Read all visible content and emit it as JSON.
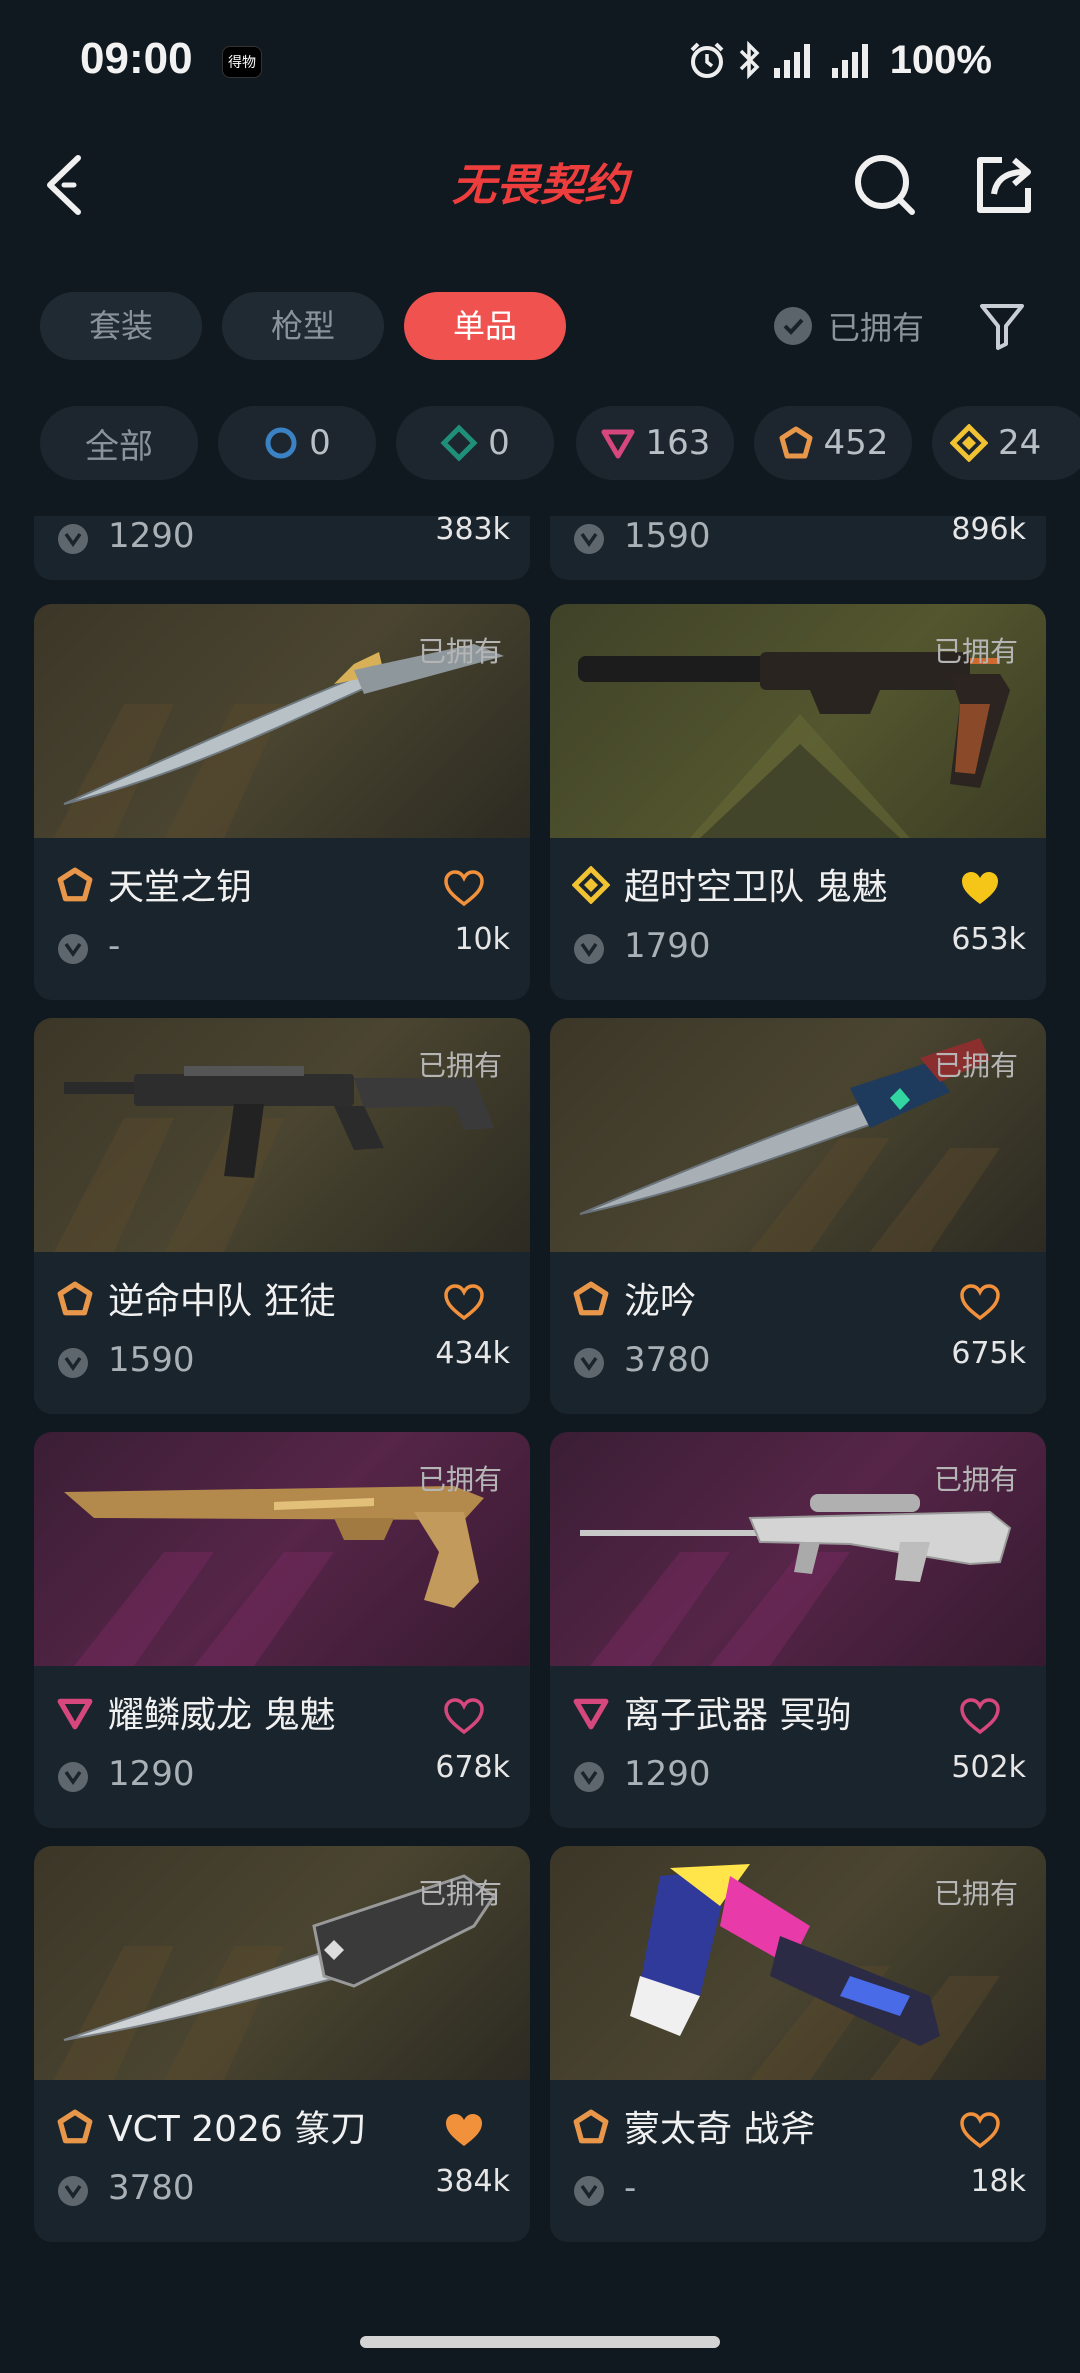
{
  "status_bar": {
    "time": "09:00",
    "app_badge": "得物",
    "battery": "100%"
  },
  "header": {
    "logo_text": "无畏契约"
  },
  "tabs": [
    {
      "label": "套装",
      "active": false
    },
    {
      "label": "枪型",
      "active": false
    },
    {
      "label": "单品",
      "active": true
    }
  ],
  "owned_filter": {
    "label": "已拥有"
  },
  "chips": [
    {
      "label": "全部"
    },
    {
      "tier": "select",
      "color": "#3b82c4",
      "count": "0"
    },
    {
      "tier": "deluxe",
      "color": "#1f8f7a",
      "count": "0"
    },
    {
      "tier": "premium",
      "color": "#d6477d",
      "count": "163"
    },
    {
      "tier": "exclusive",
      "color": "#e8964a",
      "count": "452"
    },
    {
      "tier": "ultra",
      "color": "#f1c232",
      "count": "24"
    }
  ],
  "items": [
    {
      "name": "",
      "price": "1290",
      "likes": "383k",
      "partial": "top"
    },
    {
      "name": "",
      "price": "1590",
      "likes": "896k",
      "partial": "top"
    },
    {
      "name": "天堂之钥",
      "tier": "exclusive",
      "price": "-",
      "likes": "10k",
      "owned": "已拥有",
      "favorited": false,
      "bg": "gold"
    },
    {
      "name": "超时空卫队 鬼魅",
      "tier": "ultra",
      "price": "1790",
      "likes": "653k",
      "owned": "已拥有",
      "favorited": true,
      "bg": "olive"
    },
    {
      "name": "逆命中队 狂徒",
      "tier": "exclusive",
      "price": "1590",
      "likes": "434k",
      "owned": "已拥有",
      "favorited": false,
      "bg": "gold"
    },
    {
      "name": "泷吟",
      "tier": "exclusive",
      "price": "3780",
      "likes": "675k",
      "owned": "已拥有",
      "favorited": false,
      "bg": "gold"
    },
    {
      "name": "耀鳞威龙 鬼魅",
      "tier": "premium",
      "price": "1290",
      "likes": "678k",
      "owned": "已拥有",
      "favorited": false,
      "bg": "pink"
    },
    {
      "name": "离子武器 冥驹",
      "tier": "premium",
      "price": "1290",
      "likes": "502k",
      "owned": "已拥有",
      "favorited": false,
      "bg": "pink"
    },
    {
      "name": "VCT 2026 篆刀",
      "tier": "exclusive",
      "price": "3780",
      "likes": "384k",
      "owned": "已拥有",
      "favorited": true,
      "bg": "gold"
    },
    {
      "name": "蒙太奇 战斧",
      "tier": "exclusive",
      "price": "-",
      "likes": "18k",
      "owned": "已拥有",
      "favorited": false,
      "bg": "gold"
    }
  ],
  "colors": {
    "accent": "#f0534f",
    "tier_exclusive": "#e8964a",
    "tier_ultra": "#f1c232",
    "tier_premium": "#d6477d",
    "heart_gold": "#f5c518",
    "heart_orange": "#f2913c"
  }
}
